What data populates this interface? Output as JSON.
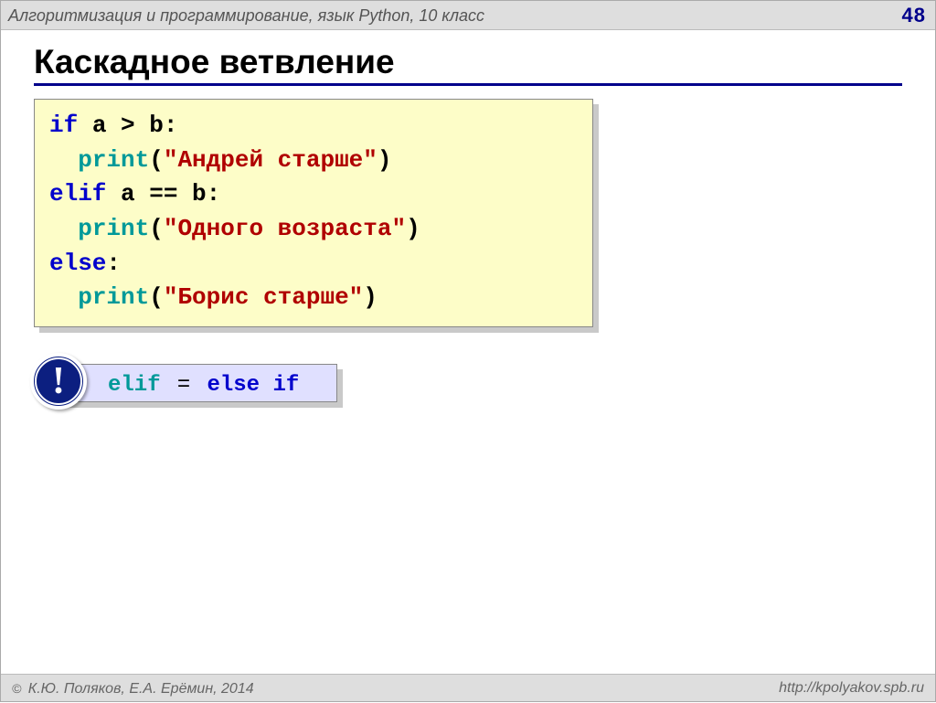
{
  "header": {
    "course": "Алгоритмизация и программирование, язык Python, 10 класс",
    "page": "48"
  },
  "title": "Каскадное ветвление",
  "code": {
    "l1": {
      "kw": "if",
      "rest": " a > b:"
    },
    "l2": {
      "indent": "  ",
      "fn": "print",
      "paren_open": "(",
      "str": "\"Андрей старше\"",
      "paren_close": ")"
    },
    "l3": {
      "kw": "elif",
      "rest": " a == b:"
    },
    "l4": {
      "indent": "  ",
      "fn": "print",
      "paren_open": "(",
      "str": "\"Одного возраста\"",
      "paren_close": ")"
    },
    "l5": {
      "kw": "else",
      "rest": ":"
    },
    "l6": {
      "indent": "  ",
      "fn": "print",
      "paren_open": "(",
      "str": "\"Борис старше\"",
      "paren_close": ")"
    }
  },
  "note": {
    "badge": "!",
    "elif": "elif",
    "eq": "=",
    "else_if": "else if"
  },
  "footer": {
    "author": "К.Ю. Поляков, Е.А. Ерёмин, 2014",
    "url": "http://kpolyakov.spb.ru",
    "copy": "©"
  }
}
